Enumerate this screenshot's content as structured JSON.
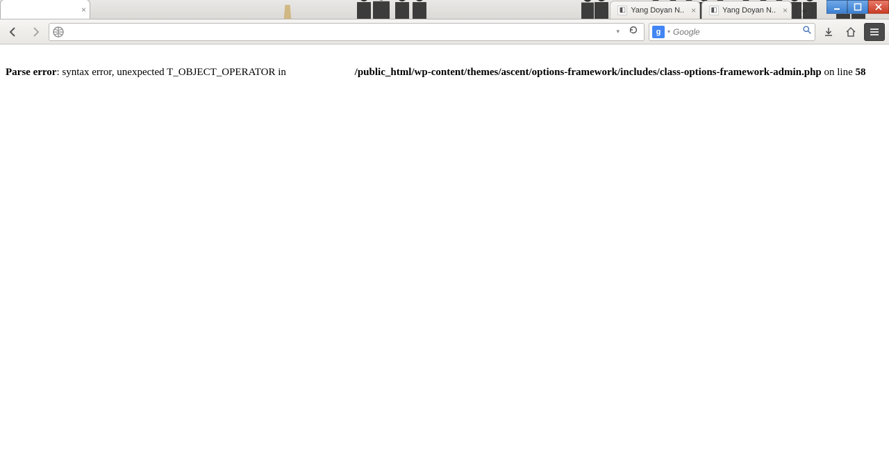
{
  "tabs": {
    "active_blank_close": "×",
    "bg1": {
      "label": "Yang Doyan N..",
      "close": "×"
    },
    "bg2": {
      "label": "Yang Doyan N..",
      "close": "×"
    },
    "newtab": "+"
  },
  "window": {
    "min_title": "Minimize",
    "max_title": "Maximize",
    "close_title": "Close"
  },
  "toolbar": {
    "back_title": "Back",
    "forward_title": "Forward",
    "url_value": "",
    "reload_title": "Reload",
    "search_engine_glyph": "g",
    "search_placeholder": "Google",
    "search_go_title": "Search",
    "downloads_title": "Downloads",
    "home_title": "Home",
    "menu_title": "Open menu"
  },
  "error": {
    "label": "Parse error",
    "message": ": syntax error, unexpected T_OBJECT_OPERATOR in ",
    "path": "/public_html/wp-content/themes/ascent/options-framework/includes/class-options-framework-admin.php",
    "on_line": " on line ",
    "line": "58"
  }
}
